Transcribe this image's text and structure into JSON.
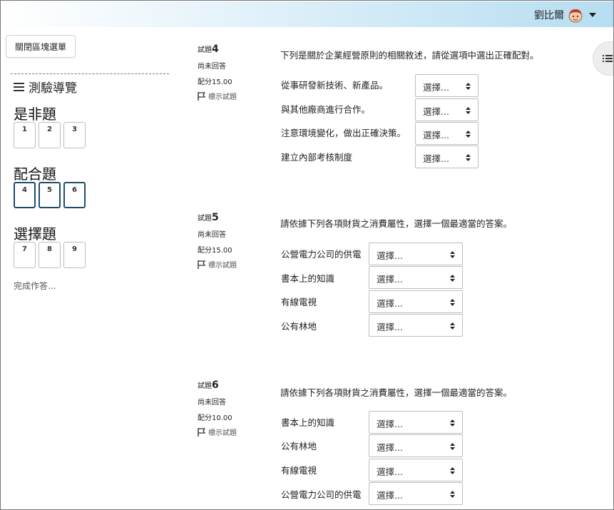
{
  "header": {
    "user_name": "劉比爾",
    "icons": {
      "avatar": "avatar-icon",
      "menu": "caret-down-icon"
    }
  },
  "sidebar": {
    "close_block_label": "關閉區塊選單",
    "nav_title": "測驗導覽",
    "sections": [
      {
        "title": "是非題",
        "buttons": [
          "1",
          "2",
          "3"
        ]
      },
      {
        "title": "配合題",
        "buttons": [
          "4",
          "5",
          "6"
        ]
      },
      {
        "title": "選擇題",
        "buttons": [
          "7",
          "8",
          "9"
        ]
      }
    ],
    "finish_label": "完成作答..."
  },
  "questions": [
    {
      "label_prefix": "試題",
      "number": "4",
      "state": "尚未回答",
      "grade": "配分15.00",
      "flag_label": "標示試題",
      "text": "下列是關於企業經營原則的相關敘述，請從選項中選出正確配對。",
      "stems": [
        "從事研發新技術、新產品。",
        "與其他廠商進行合作。",
        "注意環境變化，做出正確決策。",
        "建立內部考核制度"
      ],
      "select_value": "選擇..."
    },
    {
      "label_prefix": "試題",
      "number": "5",
      "state": "尚未回答",
      "grade": "配分15.00",
      "flag_label": "標示試題",
      "text": "請依據下列各項財貨之消費屬性，選擇一個最適當的答案。",
      "stems": [
        "公營電力公司的供電",
        "書本上的知識",
        "有線電視",
        "公有林地"
      ],
      "select_value": "選擇..."
    },
    {
      "label_prefix": "試題",
      "number": "6",
      "state": "尚未回答",
      "grade": "配分10.00",
      "flag_label": "標示試題",
      "text": "請依據下列各項財貨之消費屬性，選擇一個最適當的答案。",
      "stems": [
        "書本上的知識",
        "公有林地",
        "有線電視",
        "公營電力公司的供電"
      ],
      "select_value": "選擇..."
    }
  ],
  "colors": {
    "current_border": "#1e4d6b",
    "header_gradient_end": "#b6ddf1"
  }
}
